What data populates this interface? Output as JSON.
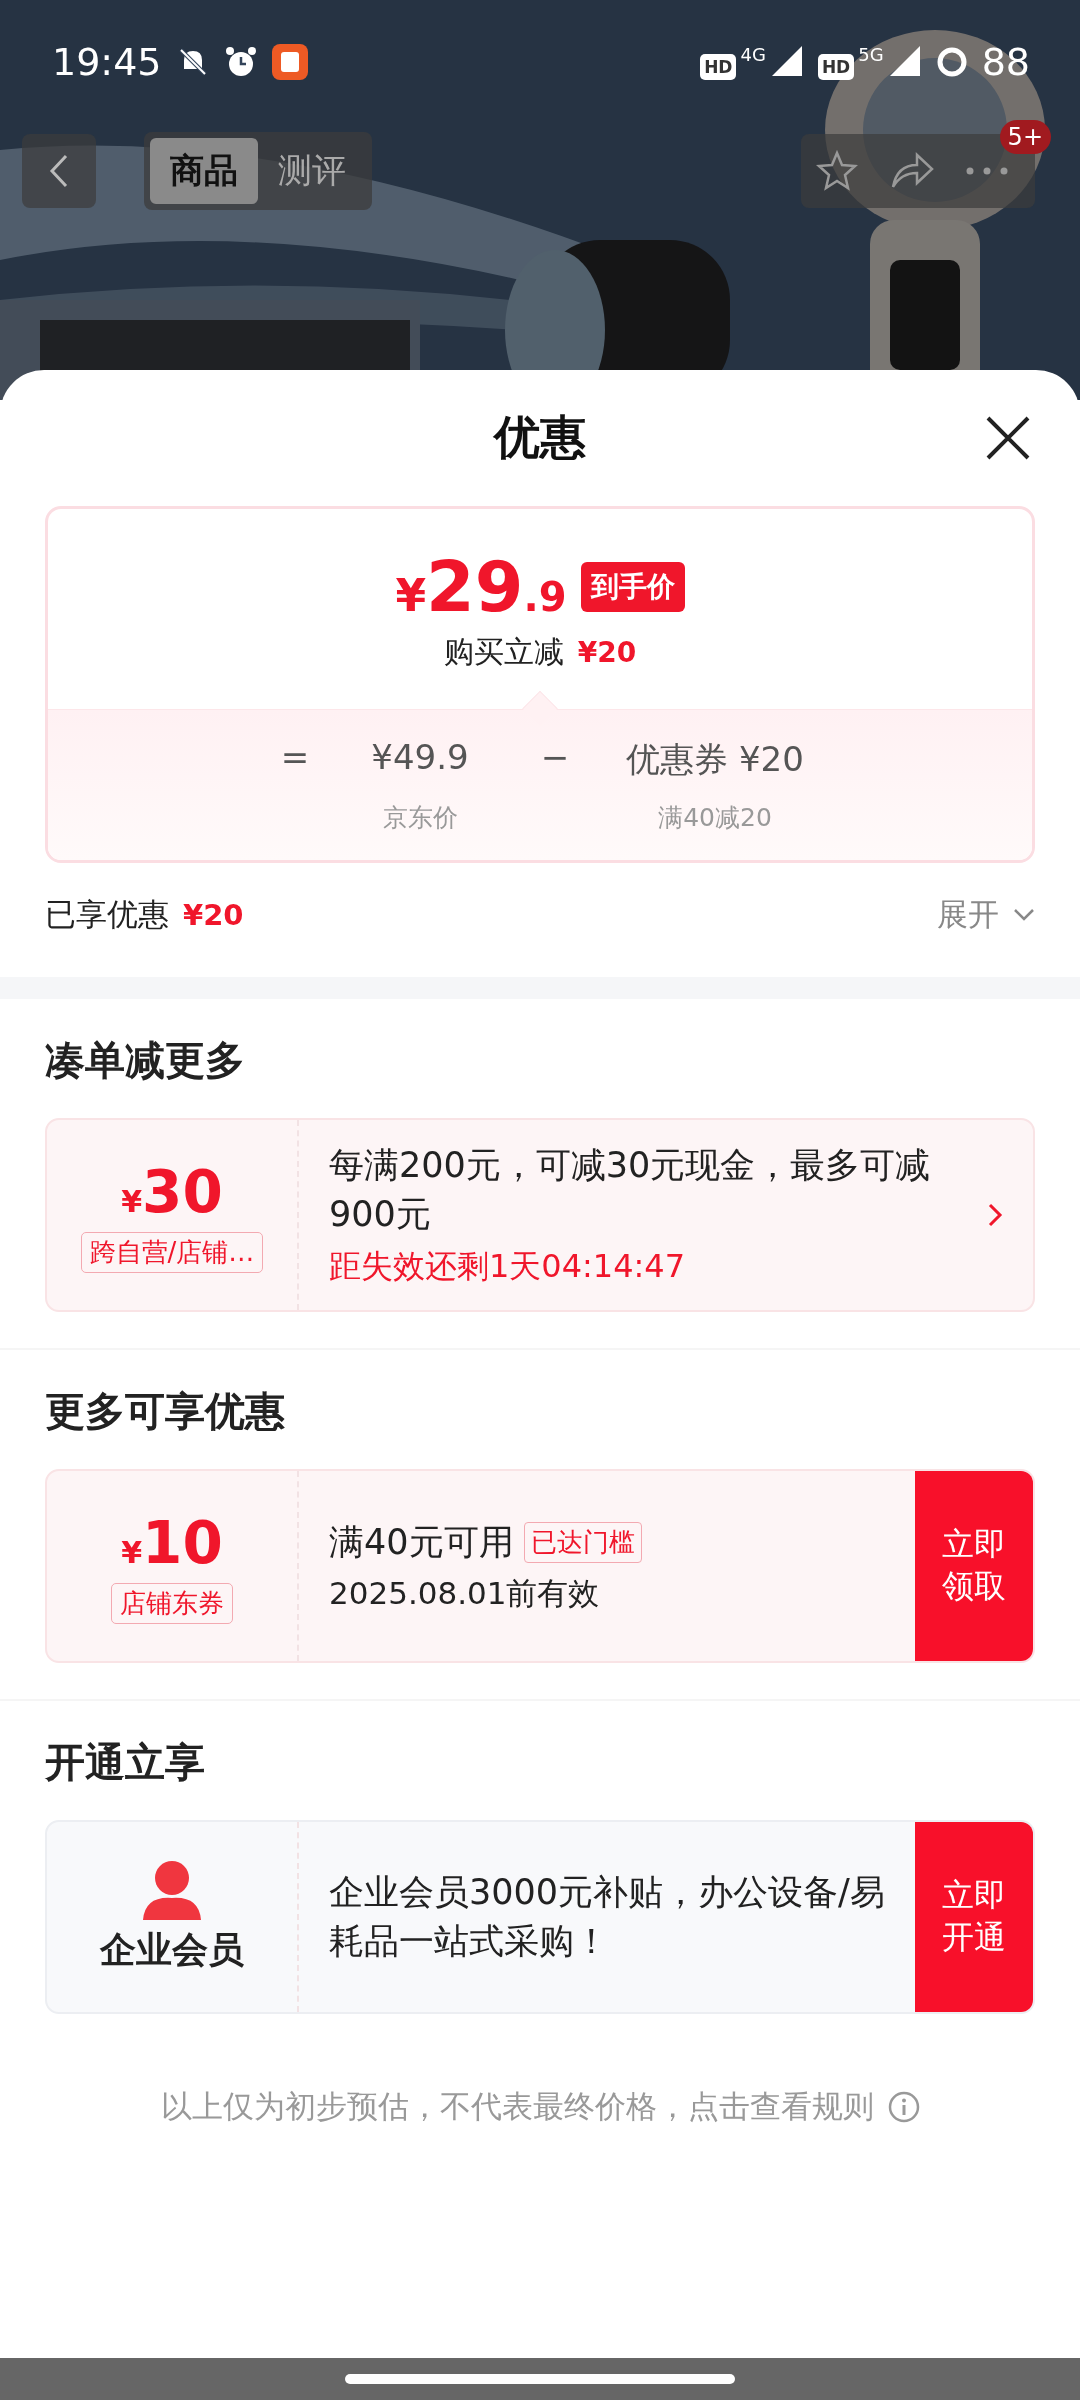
{
  "status_bar": {
    "time": "19:45",
    "signals": [
      {
        "hd": "HD",
        "net": "4G"
      },
      {
        "hd": "HD",
        "net": "5G"
      }
    ],
    "battery": "88"
  },
  "nav": {
    "tabs": [
      {
        "label": "商品",
        "selected": true
      },
      {
        "label": "测评",
        "selected": false
      }
    ],
    "badge": "5+"
  },
  "sheet": {
    "title": "优惠",
    "summary": {
      "currency": "¥",
      "price_int": "29",
      "price_dec": ".9",
      "price_tag": "到手价",
      "instant_label": "购买立减",
      "instant_amount": "¥20",
      "equals": "=",
      "base_price": "¥49.9",
      "minus": "−",
      "coupon": "优惠券 ¥20",
      "base_label": "京东价",
      "coupon_label": "满40减20"
    },
    "enjoyed": {
      "label": "已享优惠",
      "amount": "¥20",
      "expand": "展开"
    },
    "sections": [
      {
        "title": "凑单减更多",
        "card": {
          "kind": "promo",
          "currency": "¥",
          "amount": "30",
          "tag": "跨自营/店铺…",
          "text": "每满200元，可减30元现金，最多可减900元",
          "countdown": "距失效还剩1天04:14:47"
        }
      },
      {
        "title": "更多可享优惠",
        "card": {
          "kind": "coupon",
          "currency": "¥",
          "amount": "10",
          "tag": "店铺东券",
          "text": "满40元可用",
          "badge": "已达门槛",
          "validity": "2025.08.01前有效",
          "action": "立即领取"
        }
      },
      {
        "title": "开通立享",
        "card": {
          "kind": "member",
          "name": "企业会员",
          "text": " 企业会员3000元补贴，办公设备/易耗品一站式采购！",
          "action": "立即开通"
        }
      }
    ],
    "note": "以上仅为初步预估，不代表最终价格，点击查看规则"
  }
}
